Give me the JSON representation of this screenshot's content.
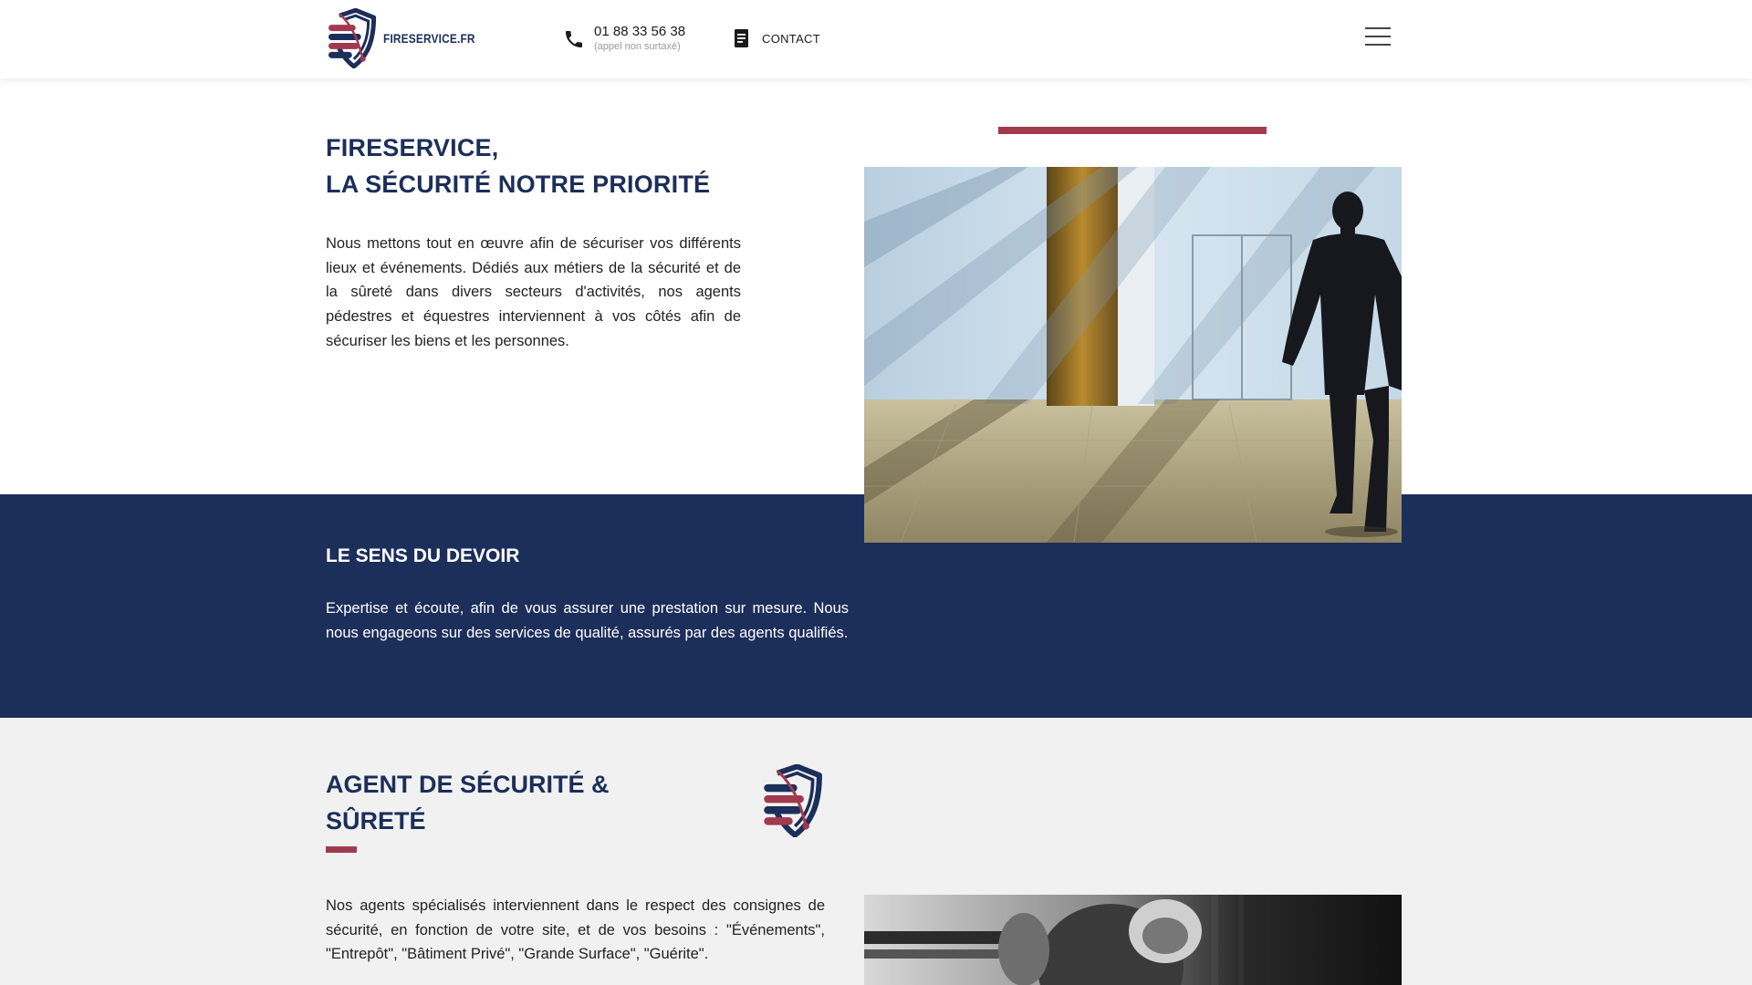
{
  "header": {
    "logo_text": "FIRESERVICE.FR",
    "phone_number": "01 88 33 56 38",
    "phone_note": "(appel non surtaxé)",
    "contact_label": "CONTACT"
  },
  "hero": {
    "title_line1": "FIRESERVICE,",
    "title_line2": "LA SÉCURITÉ NOTRE PRIORITÉ",
    "text": "Nous mettons tout en œuvre afin de sécuriser vos différents lieux et événements. Dédiés aux métiers de la sécurité et de la sûreté dans divers secteurs d'activités, nos agents pédestres et équestres interviennent à vos côtés afin de sécuriser les biens et les personnes."
  },
  "duty": {
    "title": "LE SENS DU DEVOIR",
    "text": "Expertise et écoute, afin de vous assurer une prestation sur mesure. Nous nous engageons sur des services de qualité, assurés par des agents qualifiés."
  },
  "agent": {
    "title_line1": "AGENT DE SÉCURITÉ &",
    "title_line2": "SÛRETÉ",
    "text": "Nos agents spécialisés interviennent dans le respect des consignes de sécurité, en fonction de votre site, et de vos besoins : \"Événements\", \"Entrepôt\", \"Bâtiment Privé\", \"Grande Surface\", \"Guérite\"."
  },
  "colors": {
    "navy": "#1c2e5a",
    "accent": "#a23a4f",
    "gray_bg": "#f1f1f1"
  },
  "icons": [
    "shield-logo-icon",
    "phone-icon",
    "document-icon",
    "hamburger-menu-icon"
  ]
}
